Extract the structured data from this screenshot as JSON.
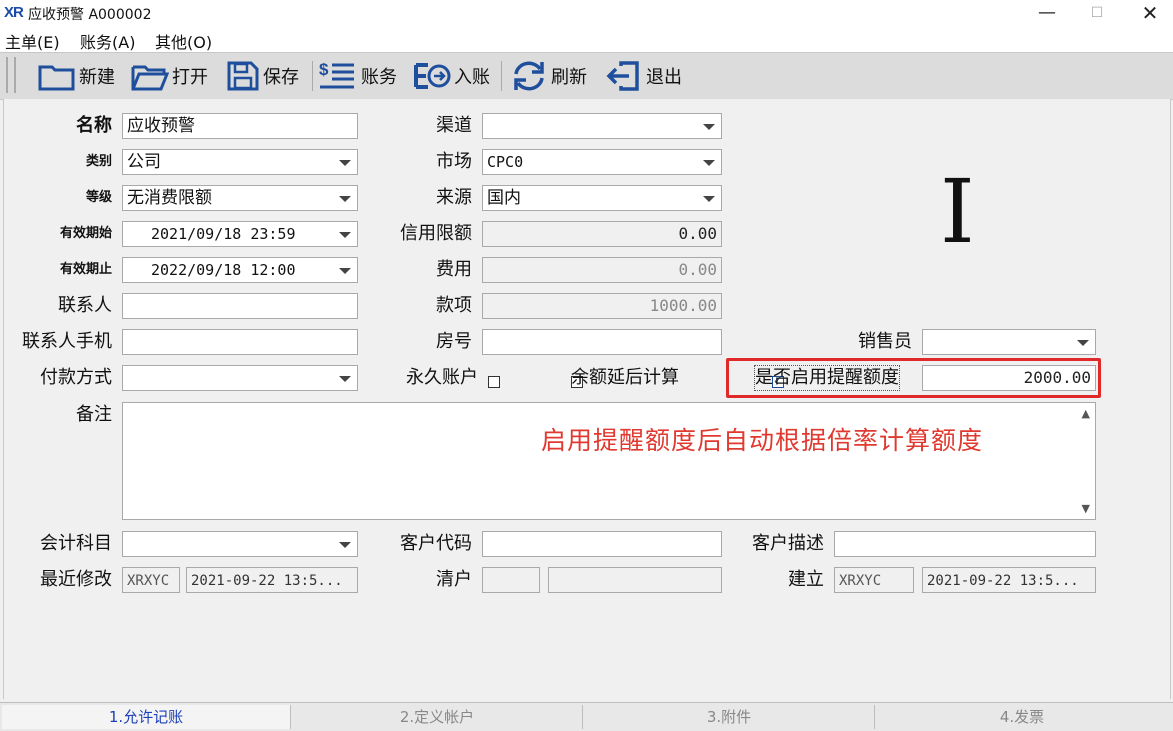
{
  "window": {
    "logo": "XR",
    "title": "应收预警  A000002",
    "minimize": "—",
    "maximize": "☐",
    "close": "✕"
  },
  "menu": [
    "主单(E)",
    "账务(A)",
    "其他(O)"
  ],
  "toolbar": {
    "new": "新建",
    "open": "打开",
    "save": "保存",
    "accounts": "账务",
    "post": "入账",
    "refresh": "刷新",
    "exit": "退出"
  },
  "form": {
    "name": {
      "label": "名称",
      "value": "应收预警"
    },
    "category": {
      "label": "类别",
      "value": "公司"
    },
    "level": {
      "label": "等级",
      "value": "无消费限额"
    },
    "valid_start": {
      "label": "有效期始",
      "value": "2021/09/18 23:59"
    },
    "valid_end": {
      "label": "有效期止",
      "value": "2022/09/18 12:00"
    },
    "contact": {
      "label": "联系人",
      "value": ""
    },
    "contact_mobile": {
      "label": "联系人手机",
      "value": ""
    },
    "payment_method": {
      "label": "付款方式",
      "value": ""
    },
    "channel": {
      "label": "渠道",
      "value": ""
    },
    "market": {
      "label": "市场",
      "value": "CPC0"
    },
    "source": {
      "label": "来源",
      "value": "国内"
    },
    "credit_limit": {
      "label": "信用限额",
      "value": "0.00"
    },
    "fee": {
      "label": "费用",
      "value": "0.00"
    },
    "payment": {
      "label": "款项",
      "value": "1000.00"
    },
    "room_no": {
      "label": "房号",
      "value": ""
    },
    "salesperson": {
      "label": "销售员",
      "value": ""
    },
    "permanent_account": {
      "label": "永久账户",
      "checked": false
    },
    "deferred_balance": {
      "label": "余额延后计算",
      "checked": false
    },
    "reminder_enabled": {
      "label": "是否启用提醒额度",
      "checked": true,
      "check_glyph": "✓"
    },
    "reminder_amount": {
      "value": "2000.00"
    },
    "remark": {
      "label": "备注",
      "value": "",
      "scroll_up": "▲",
      "scroll_down": "▼"
    },
    "account_subject": {
      "label": "会计科目",
      "value": ""
    },
    "customer_code": {
      "label": "客户代码",
      "value": ""
    },
    "customer_desc": {
      "label": "客户描述",
      "value": ""
    },
    "last_modified": {
      "label": "最近修改",
      "user": "XRXYC",
      "time": "2021-09-22 13:5..."
    },
    "checkout": {
      "label": "清户",
      "value1": "",
      "value2": ""
    },
    "created": {
      "label": "建立",
      "user": "XRXYC",
      "time": "2021-09-22 13:5..."
    }
  },
  "annotation": "启用提醒额度后自动根据倍率计算额度",
  "cursor_glyph": "I",
  "tabs": [
    "1.允许记账",
    "2.定义帐户",
    "3.附件",
    "4.发票"
  ],
  "colors": {
    "annotation": "#e03a30",
    "highlight_border": "#e02a2a",
    "active_tab": "#1b3fb8",
    "toolbar_icon": "#1f4e9c"
  }
}
